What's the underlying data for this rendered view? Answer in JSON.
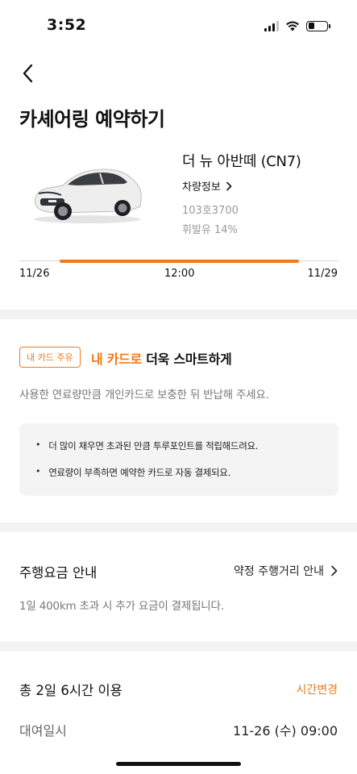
{
  "status_bar": {
    "time": "3:52"
  },
  "header": {
    "title": "카셰어링 예약하기"
  },
  "car": {
    "name": "더 뉴 아반떼 (CN7)",
    "info_link": "차량정보",
    "plate": "103호3700",
    "fuel": "휘발유 14%",
    "color_body": "#ececec"
  },
  "timeline": {
    "start": "11/26",
    "middle": "12:00",
    "end": "11/29",
    "progress_start": 0.125,
    "progress_end": 0.875,
    "accent": "#ee7a1c"
  },
  "card_section": {
    "badge": "내 카드 주유",
    "headline_accent": "내 카드로",
    "headline_rest": " 더욱 스마트하게",
    "description": "사용한 연료량만큼 개인카드로 보충한 뒤 반납해 주세요.",
    "bullets": [
      "더 많이 채우면 초과된 만큼 투루포인트를 적립해드려요.",
      "연료량이 부족하면 예약한 카드로 자동 결제되요."
    ]
  },
  "fee_section": {
    "title": "주행요금 안내",
    "link": "약정 주행거리 안내",
    "description": "1일 400km 초과 시 추가 요금이 결제됩니다."
  },
  "usage_section": {
    "title": "총 2일 6시간 이용",
    "change_link": "시간변경",
    "rent_label": "대여일시",
    "rent_value": "11-26 (수) 09:00"
  },
  "icons": {
    "back": "chevron-left-icon",
    "info_chevron": "chevron-right-icon",
    "fee_chevron": "chevron-right-icon"
  }
}
